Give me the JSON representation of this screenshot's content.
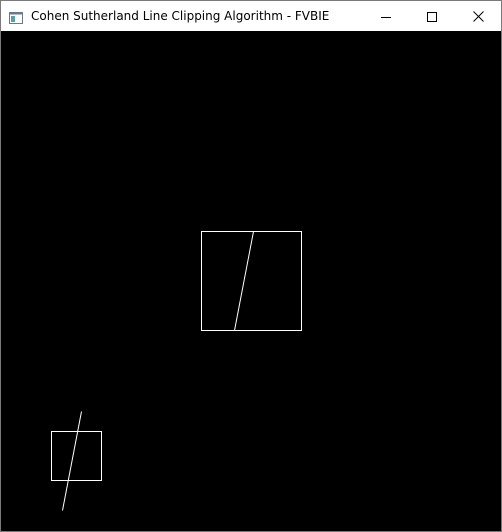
{
  "window": {
    "title": "Cohen Sutherland Line Clipping Algorithm - FVBIE",
    "app_icon": "window-app-icon",
    "controls": {
      "minimize_icon": "minimize-icon",
      "maximize_icon": "maximize-icon",
      "close_icon": "close-icon"
    }
  },
  "canvas": {
    "background_color": "#000000",
    "stroke_color": "#ffffff"
  }
}
